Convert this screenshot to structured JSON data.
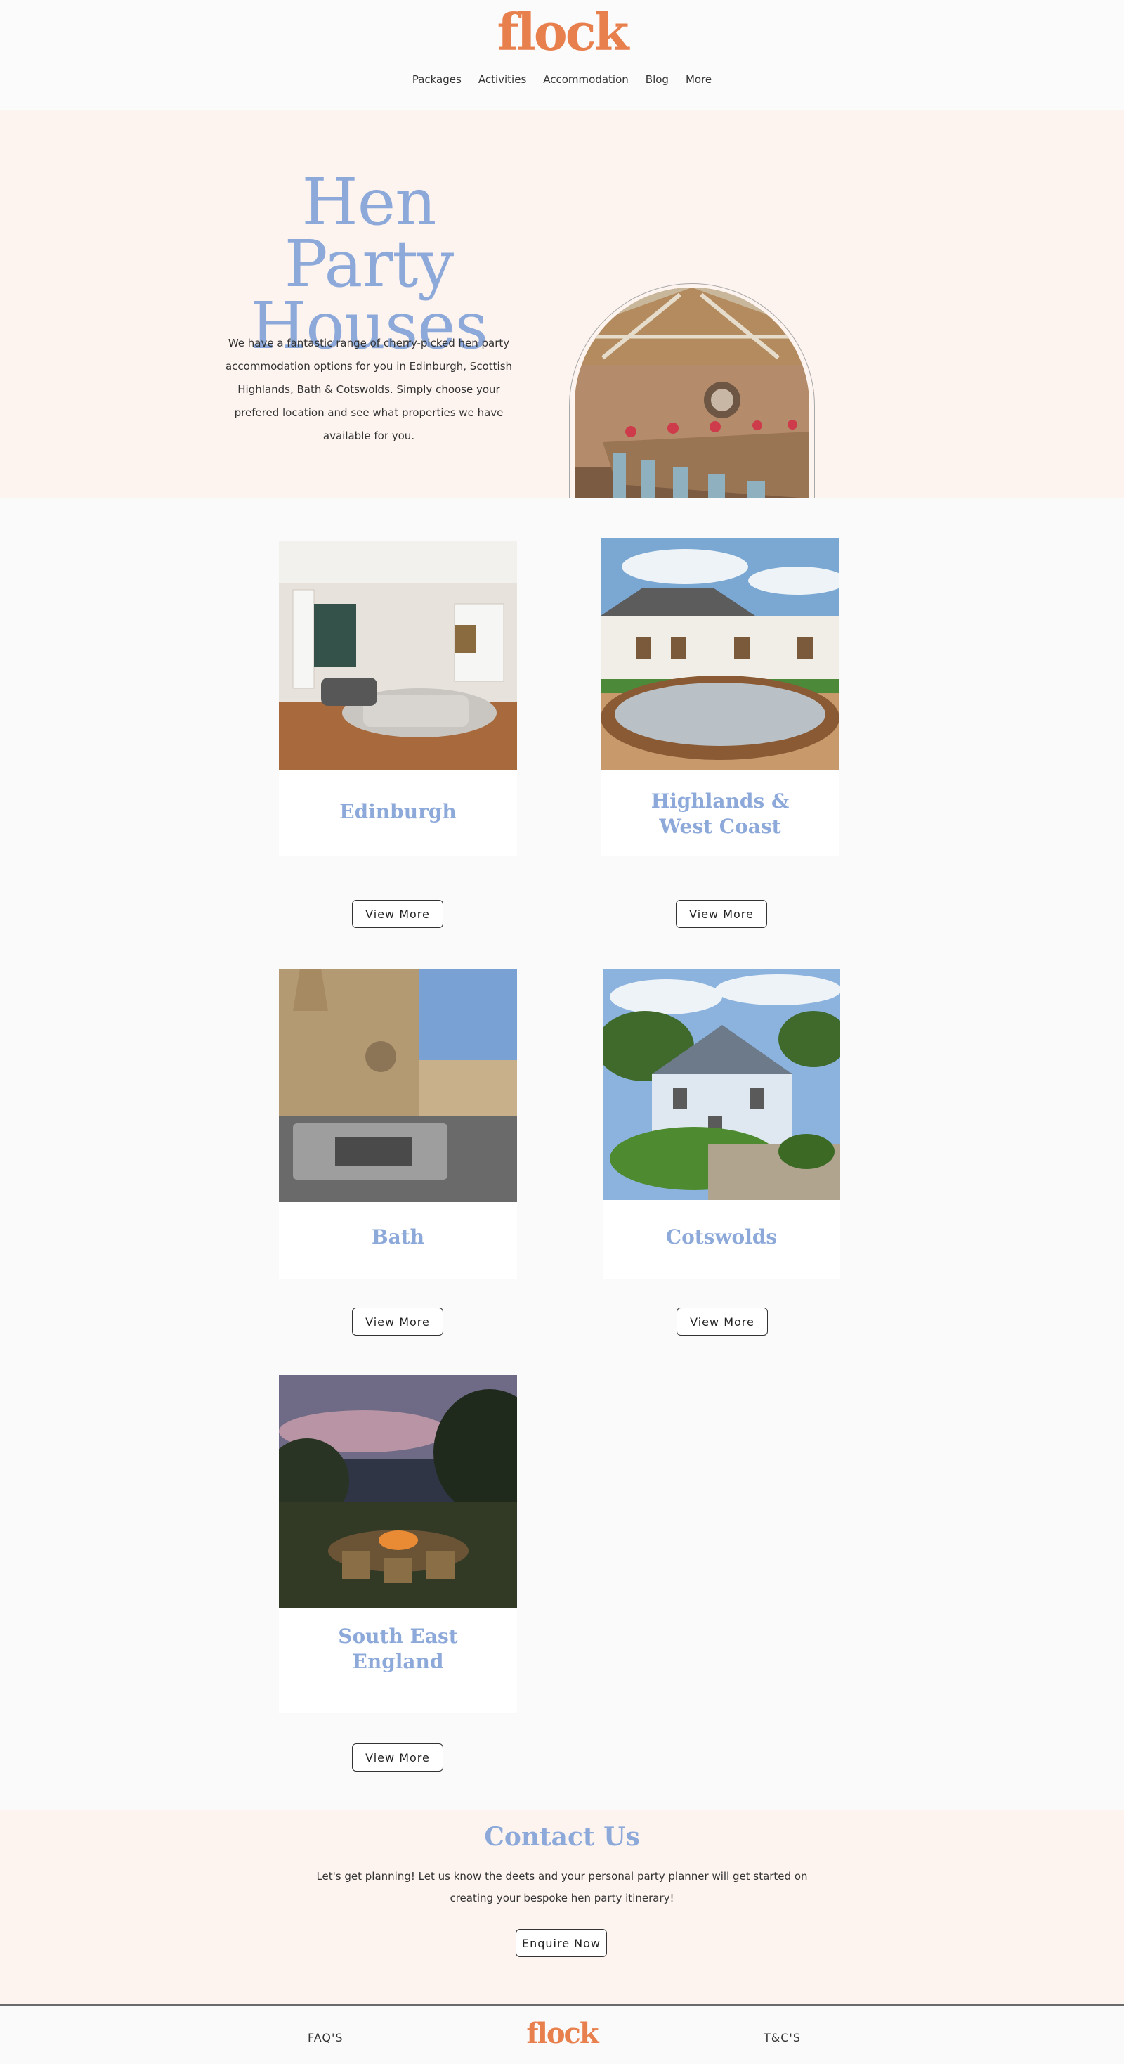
{
  "header": {
    "logo": "flock",
    "nav": [
      "Packages",
      "Activities",
      "Accommodation",
      "Blog",
      "More"
    ]
  },
  "hero": {
    "title_line1": "Hen Party",
    "title_line2": "Houses",
    "description": "We have a fantastic range of cherry-picked hen party accommodation options for you in Edinburgh, Scottish Highlands, Bath & Cotswolds.  Simply choose your prefered location and see what properties we have available for you."
  },
  "destinations": [
    {
      "name": "Edinburgh",
      "button": "View More"
    },
    {
      "name_line1": "Highlands &",
      "name_line2": "West Coast",
      "button": "View More"
    },
    {
      "name": "Bath",
      "button": "View More"
    },
    {
      "name": "Cotswolds",
      "button": "View More"
    },
    {
      "name_line1": "South East",
      "name_line2": "England",
      "button": "View More"
    }
  ],
  "contact": {
    "title": "Contact Us",
    "text": "Let's get planning!  Let us know the deets and your personal party planner will get started on creating your bespoke hen party itinerary!",
    "button": "Enquire Now"
  },
  "footer": {
    "faq": "FAQ'S",
    "logo": "flock",
    "tc": "T&C'S"
  },
  "colors": {
    "brand_orange": "#e8804e",
    "heading_blue": "#8da9da",
    "blush_background": "#fdf4f0"
  }
}
